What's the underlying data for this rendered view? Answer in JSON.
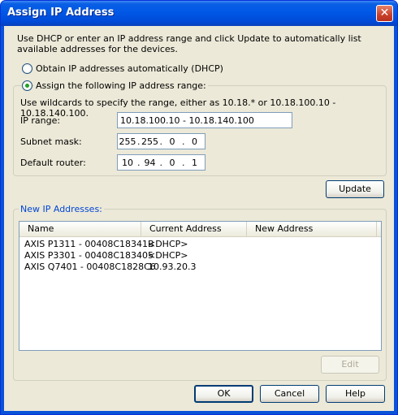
{
  "window": {
    "title": "Assign IP Address",
    "close_glyph": "✕"
  },
  "intro_text": "Use DHCP or enter an IP address range and click Update to automatically list available addresses for the devices.",
  "options": {
    "dhcp_label": "Obtain IP addresses automatically (DHCP)",
    "range_label": "Assign the following IP address range:",
    "selected": "range"
  },
  "range": {
    "hint": "Use wildcards to specify the range, either as 10.18.* or 10.18.100.10 - 10.18.140.100.",
    "ip_range_label": "IP range:",
    "ip_range_value": "10.18.100.10 - 10.18.140.100",
    "subnet_label": "Subnet mask:",
    "subnet_octets": [
      "255",
      "255",
      "0",
      "0"
    ],
    "router_label": "Default router:",
    "router_octets": [
      "10",
      "94",
      "0",
      "1"
    ]
  },
  "update_button": "Update",
  "new_ips": {
    "group_label": "New IP Addresses:",
    "columns": [
      "Name",
      "Current Address",
      "New Address"
    ],
    "rows": [
      {
        "name": "AXIS P1311 - 00408C18341B",
        "current": "<DHCP>",
        "new": ""
      },
      {
        "name": "AXIS P3301 - 00408C183405",
        "current": "<DHCP>",
        "new": ""
      },
      {
        "name": "AXIS Q7401 - 00408C1828C6",
        "current": "10.93.20.3",
        "new": ""
      }
    ],
    "edit_button": "Edit"
  },
  "footer": {
    "ok": "OK",
    "cancel": "Cancel",
    "help": "Help"
  },
  "colors": {
    "title_bar": "#0058e6",
    "dialog_bg": "#ece9d8",
    "label_blue": "#0046d5"
  }
}
